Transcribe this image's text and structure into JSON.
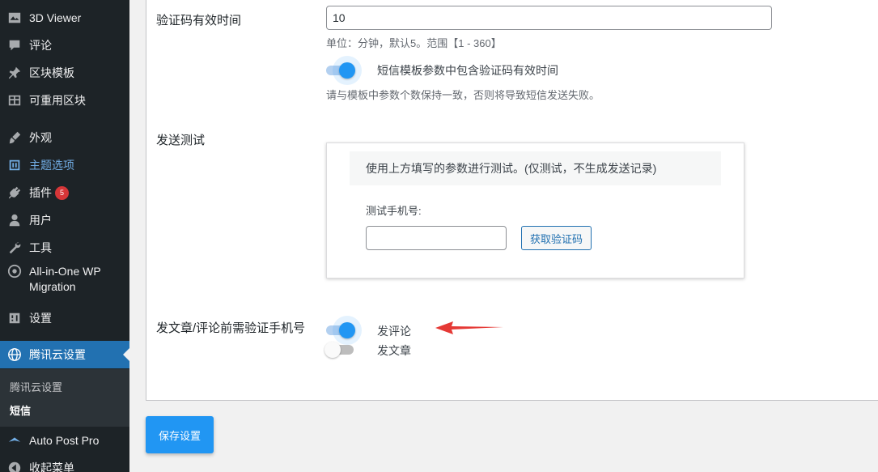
{
  "sidebar": {
    "items": [
      {
        "label": "3D Viewer",
        "icon": "image-icon"
      },
      {
        "label": "评论",
        "icon": "comment-icon"
      },
      {
        "label": "区块模板",
        "icon": "pin-icon"
      },
      {
        "label": "可重用区块",
        "icon": "table-icon"
      },
      {
        "label": "外观",
        "icon": "brush-icon"
      },
      {
        "label": "主题选项",
        "icon": "theme-icon"
      },
      {
        "label": "插件",
        "icon": "plugin-icon",
        "badge": "5"
      },
      {
        "label": "用户",
        "icon": "user-icon"
      },
      {
        "label": "工具",
        "icon": "wrench-icon"
      },
      {
        "label": "All-in-One WP Migration",
        "icon": "migration-icon"
      },
      {
        "label": "设置",
        "icon": "settings-icon"
      },
      {
        "label": "腾讯云设置",
        "icon": "globe-icon"
      },
      {
        "label": "Auto Post Pro",
        "icon": "autopost-icon"
      },
      {
        "label": "收起菜单",
        "icon": "collapse-icon"
      }
    ],
    "submenu": [
      {
        "label": "腾讯云设置"
      },
      {
        "label": "短信"
      }
    ]
  },
  "form": {
    "expiry": {
      "label": "验证码有效时间",
      "value": "10",
      "hint": "单位：分钟，默认5。范围【1 - 360】",
      "toggle_label": "短信模板参数中包含验证码有效时间",
      "toggle_on": true,
      "toggle_hint": "请与模板中参数个数保持一致，否则将导致短信发送失败。"
    },
    "send_test": {
      "label": "发送测试",
      "note": "使用上方填写的参数进行测试。(仅测试，不生成发送记录)",
      "phone_label": "测试手机号:",
      "phone_value": "",
      "button": "获取验证码"
    },
    "verify": {
      "label": "发文章/评论前需验证手机号",
      "options": [
        {
          "label": "发评论",
          "on": true
        },
        {
          "label": "发文章",
          "on": false
        }
      ]
    }
  },
  "save_button": "保存设置",
  "colors": {
    "sidebar_bg": "#1d2327",
    "current_menu": "#2271b1",
    "toggle_on": "#2196f3",
    "arrow": "#e53935",
    "badge": "#d63638"
  }
}
